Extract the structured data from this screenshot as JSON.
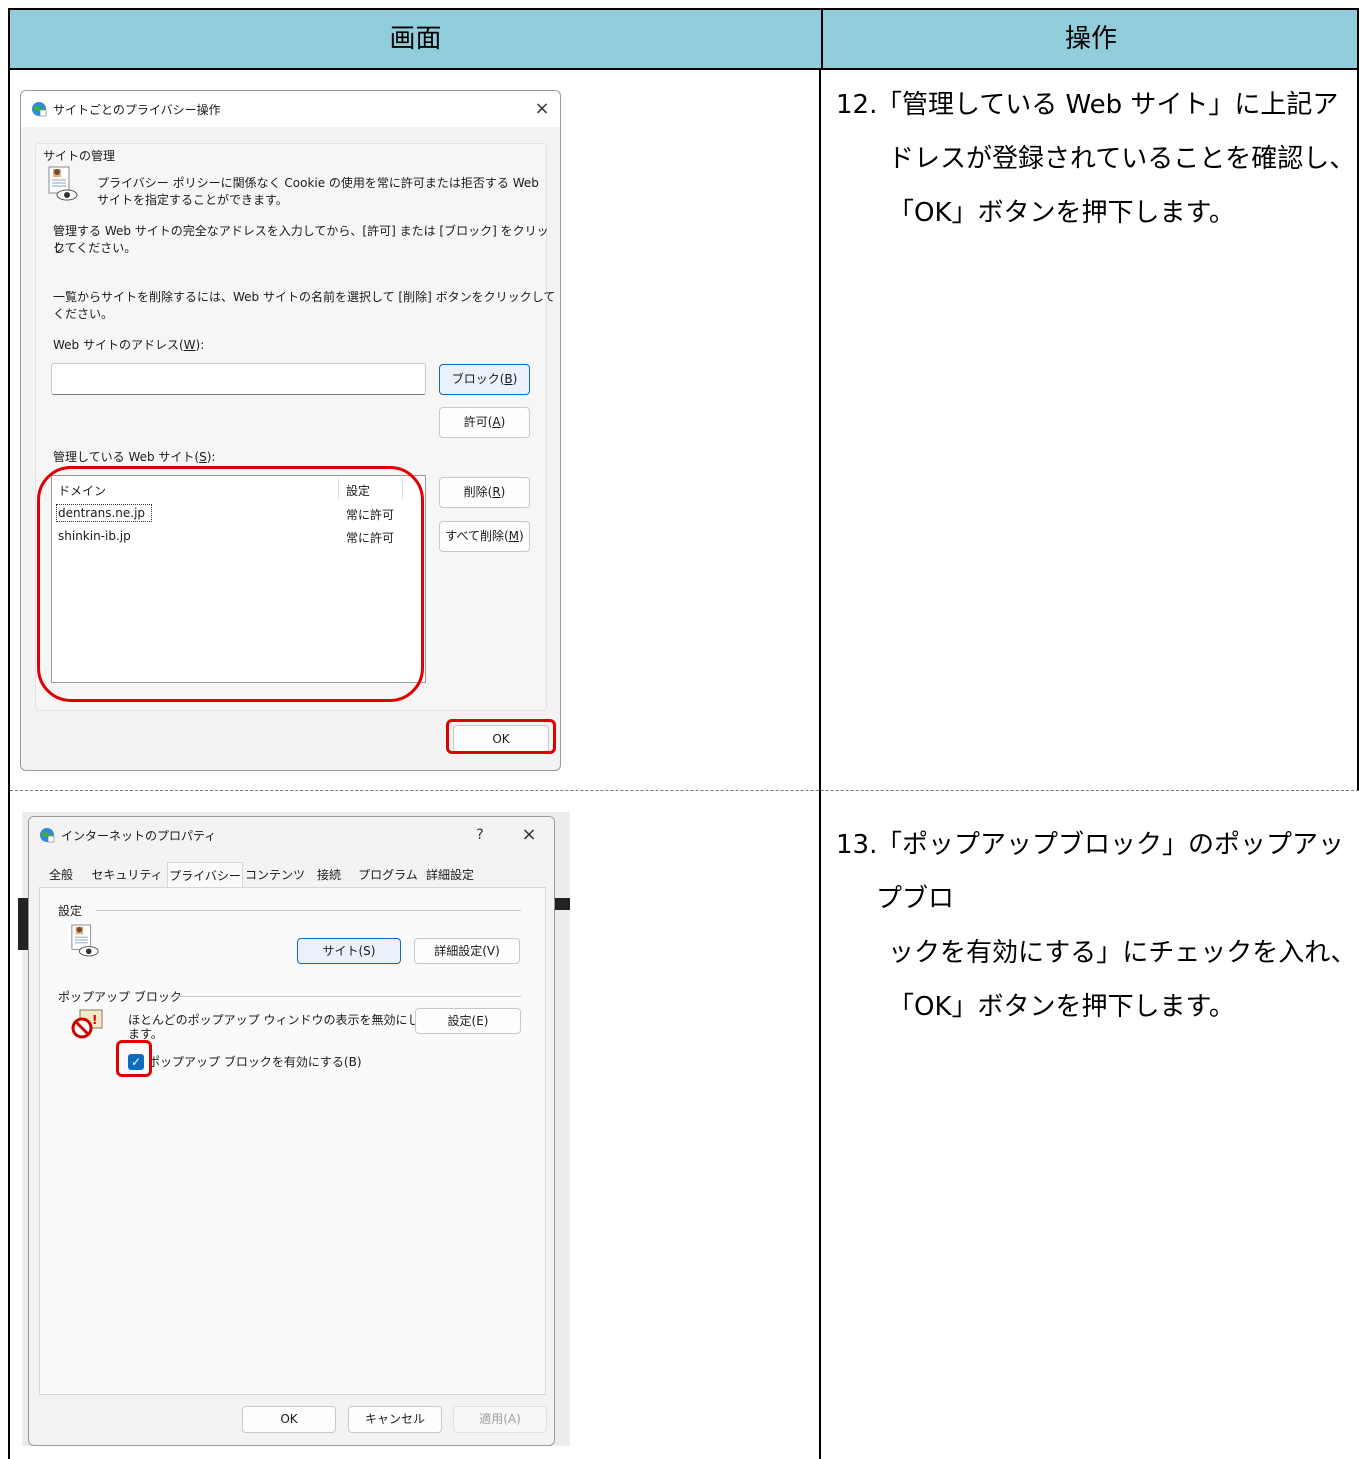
{
  "table": {
    "header_left": "画面",
    "header_right": "操作"
  },
  "steps": [
    {
      "number": "12.",
      "lines": [
        "「管理している Web サイト」に上記ア",
        "ドレスが登録されていることを確認し、",
        "「OK」ボタンを押下します。"
      ]
    },
    {
      "number": "13.",
      "lines": [
        "「ポップアップブロック」のポップアップブロ",
        "ックを有効にする」にチェックを入れ、",
        "「OK」ボタンを押下します。"
      ]
    }
  ],
  "dialog1": {
    "title": "サイトごとのプライバシー操作",
    "close": "×",
    "group_label": "サイトの管理",
    "intro": [
      "プライバシー ポリシーに関係なく Cookie の使用を常に許可または拒否する Web",
      "サイトを指定することができます。"
    ],
    "instruction1": [
      "管理する Web サイトの完全なアドレスを入力してから、[許可] または [ブロック] をクリック",
      "してください。"
    ],
    "instruction2": [
      "一覧からサイトを削除するには、Web サイトの名前を選択して [削除] ボタンをクリックして",
      "ください。"
    ],
    "address_label": "Web サイトのアドレス(",
    "address_key": "W",
    "address_label_end": "):",
    "address_value": "",
    "block_button": "ブロック(",
    "block_key": "B",
    "allow_button": "許可(",
    "allow_key": "A",
    "managed_label": "管理している Web サイト(",
    "managed_key": "S",
    "managed_label_end": "):",
    "columns": [
      "ドメイン",
      "設定"
    ],
    "rows": [
      {
        "domain": "dentrans.ne.jp",
        "setting": "常に許可"
      },
      {
        "domain": "shinkin-ib.jp",
        "setting": "常に許可"
      }
    ],
    "delete_button": "削除(",
    "delete_key": "R",
    "delete_all_button": "すべて削除(",
    "delete_all_key": "M",
    "paren_close": ")",
    "ok_button": "OK"
  },
  "dialog2": {
    "title": "インターネットのプロパティ",
    "help": "?",
    "close": "×",
    "tabs": [
      "全般",
      "セキュリティ",
      "プライバシー",
      "コンテンツ",
      "接続",
      "プログラム",
      "詳細設定"
    ],
    "active_tab": "プライバシー",
    "settings_label": "設定",
    "sites_button": "サイト(S)",
    "advanced_button": "詳細設定(V)",
    "popup_label": "ポップアップ ブロック",
    "popup_desc": [
      "ほとんどのポップアップ ウィンドウの表示を無効にし",
      "ます。"
    ],
    "popup_settings_button": "設定(E)",
    "popup_checkbox_label": "ポップアップ ブロックを有効にする(B)",
    "popup_checked": true,
    "ok_button": "OK",
    "cancel_button": "キャンセル",
    "apply_button": "適用(A)"
  },
  "icons": {
    "globe": "globe-icon",
    "privacy": "privacy-eye-icon",
    "popup_block": "popup-block-icon",
    "check": "checkmark-icon"
  },
  "colors": {
    "header_bg": "#92cddc",
    "highlight": "#e00000",
    "accent": "#0f6cbd"
  }
}
